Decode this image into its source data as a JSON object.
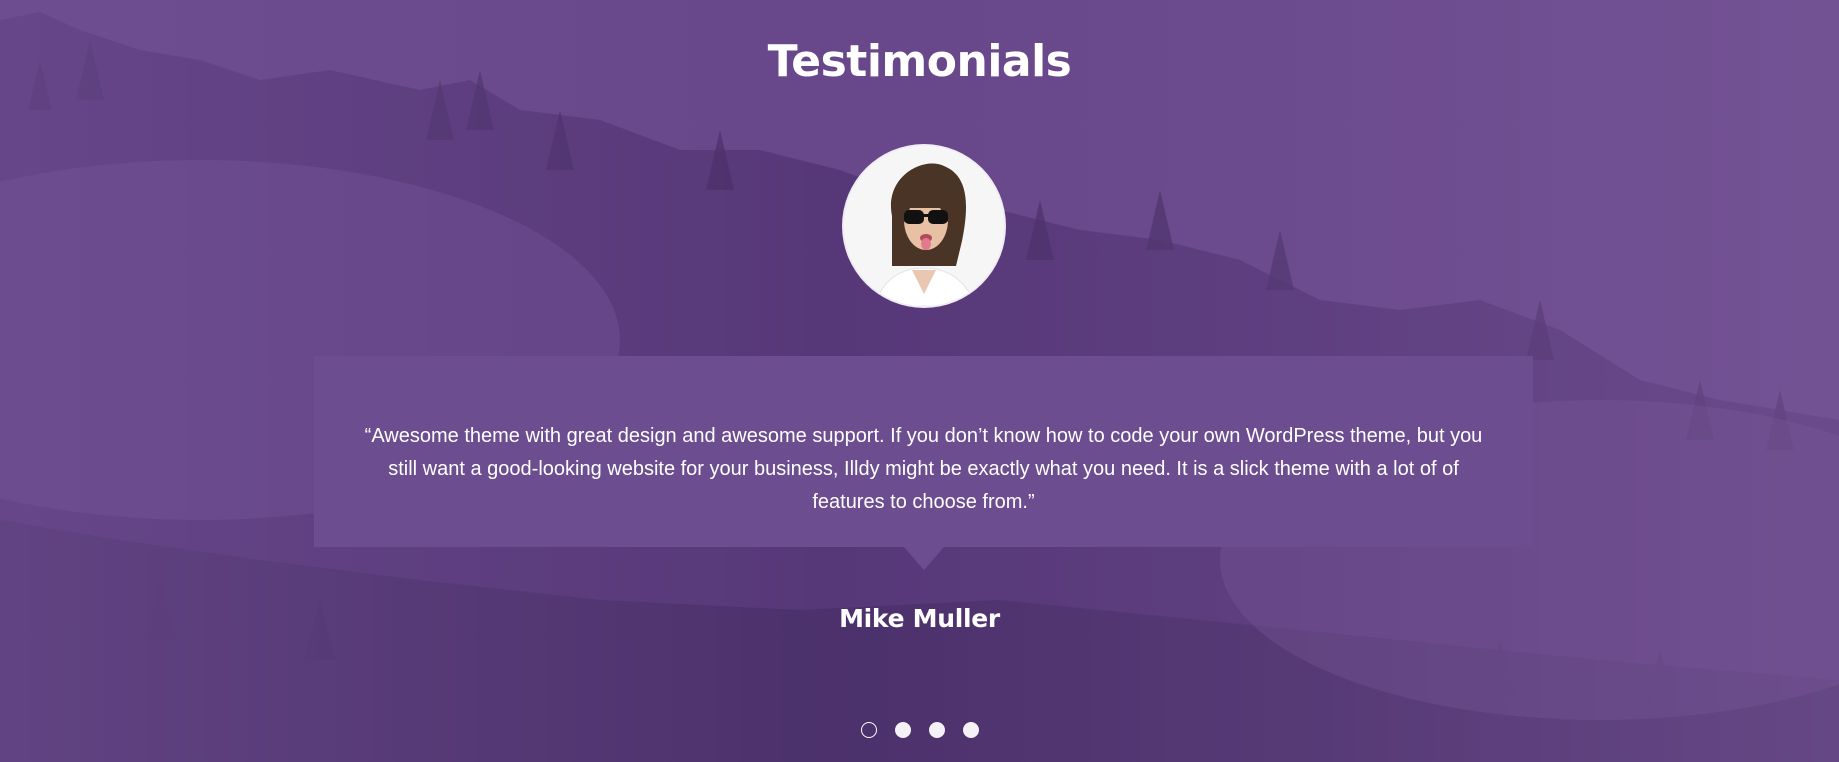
{
  "section": {
    "title": "Testimonials",
    "background_color": "#6b4c8e",
    "overlay_color": "#603e86"
  },
  "testimonial": {
    "avatar_icon": "person-avatar",
    "quote": "“Awesome theme with great design and awesome support. If you don’t know how to code your own WordPress theme, but you still want a good-looking website for your business, Illdy might be exactly what you need. It is a slick theme with a lot of of features to choose from.”",
    "author": "Mike Muller"
  },
  "carousel": {
    "slides": 4,
    "active_index": 0
  }
}
